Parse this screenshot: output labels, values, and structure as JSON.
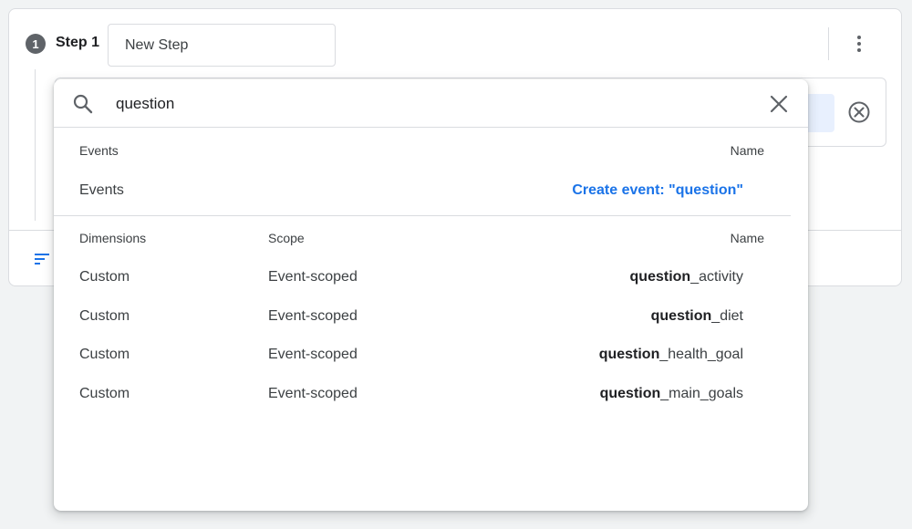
{
  "step": {
    "number": "1",
    "label": "Step 1",
    "name_value": "New Step"
  },
  "search": {
    "query": "question"
  },
  "events_section": {
    "header_left": "Events",
    "header_right": "Name",
    "row_label": "Events",
    "create_link": "Create event: \"question\""
  },
  "dimensions_section": {
    "header_dimensions": "Dimensions",
    "header_scope": "Scope",
    "header_name": "Name",
    "rows": [
      {
        "dimension": "Custom",
        "scope": "Event-scoped",
        "name_bold": "question",
        "name_rest": "_activity"
      },
      {
        "dimension": "Custom",
        "scope": "Event-scoped",
        "name_bold": "question",
        "name_rest": "_diet"
      },
      {
        "dimension": "Custom",
        "scope": "Event-scoped",
        "name_bold": "question",
        "name_rest": "_health_goal"
      },
      {
        "dimension": "Custom",
        "scope": "Event-scoped",
        "name_bold": "question",
        "name_rest": "_main_goals"
      }
    ]
  },
  "icons": {
    "search": "search-icon",
    "close": "close-icon",
    "more": "more-vert-icon",
    "remove": "remove-circle-icon",
    "filter": "filter-icon"
  },
  "colors": {
    "accent": "#1a73e8",
    "chip_bg": "#e8f0fe",
    "step_badge": "#5f6368"
  }
}
